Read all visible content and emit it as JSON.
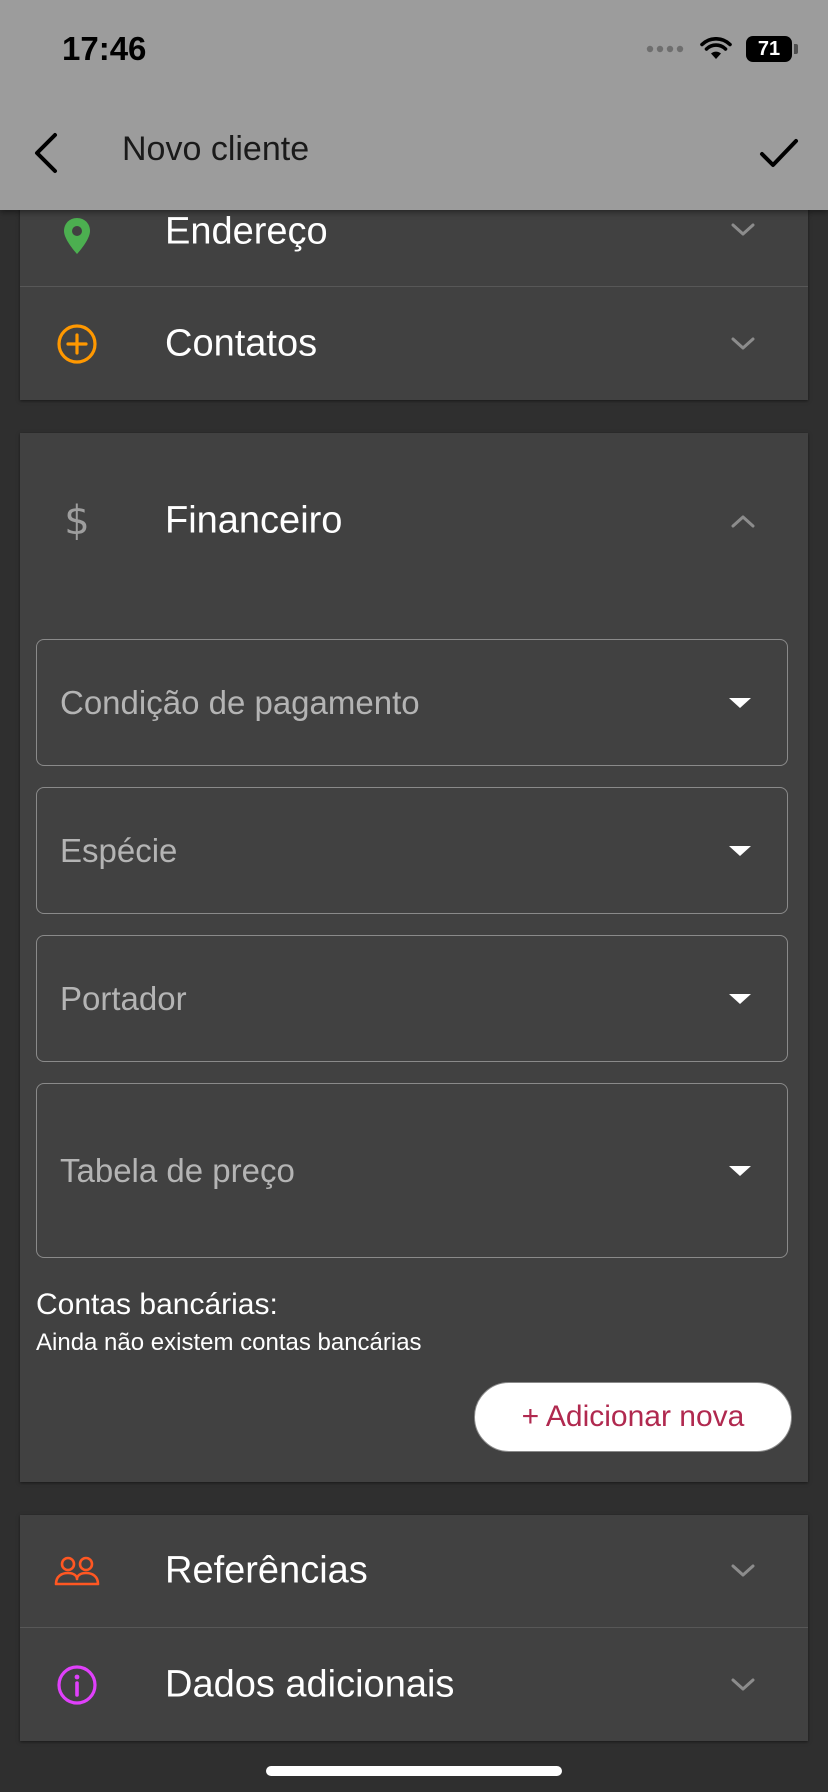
{
  "status_bar": {
    "time": "17:46",
    "battery": "71"
  },
  "header": {
    "title": "Novo cliente"
  },
  "sections": {
    "endereco": {
      "label": "Endereço"
    },
    "contatos": {
      "label": "Contatos"
    },
    "financeiro": {
      "label": "Financeiro"
    },
    "referencias": {
      "label": "Referências"
    },
    "dados_adicionais": {
      "label": "Dados adicionais"
    }
  },
  "financeiro_form": {
    "condicao_pagamento": {
      "placeholder": "Condição de pagamento"
    },
    "especie": {
      "placeholder": "Espécie"
    },
    "portador": {
      "placeholder": "Portador"
    },
    "tabela_preco": {
      "placeholder": "Tabela de preço"
    },
    "bank_accounts": {
      "title": "Contas bancárias:",
      "empty_text": "Ainda não existem contas bancárias",
      "add_label": "+ Adicionar nova"
    }
  },
  "icons": {
    "endereco": "location-pin-icon",
    "contatos": "plus-circle-icon",
    "financeiro": "dollar-icon",
    "referencias": "people-icon",
    "dados_adicionais": "info-icon"
  },
  "colors": {
    "header_bg": "#9c9c9c",
    "background": "#2f2f2f",
    "card_bg": "#414141",
    "location_icon": "#4caf50",
    "contatos_icon": "#ff9800",
    "financeiro_icon": "#9e9e9e",
    "referencias_icon": "#ff5722",
    "dados_icon": "#e040fb",
    "add_button_text": "#b0294f"
  }
}
